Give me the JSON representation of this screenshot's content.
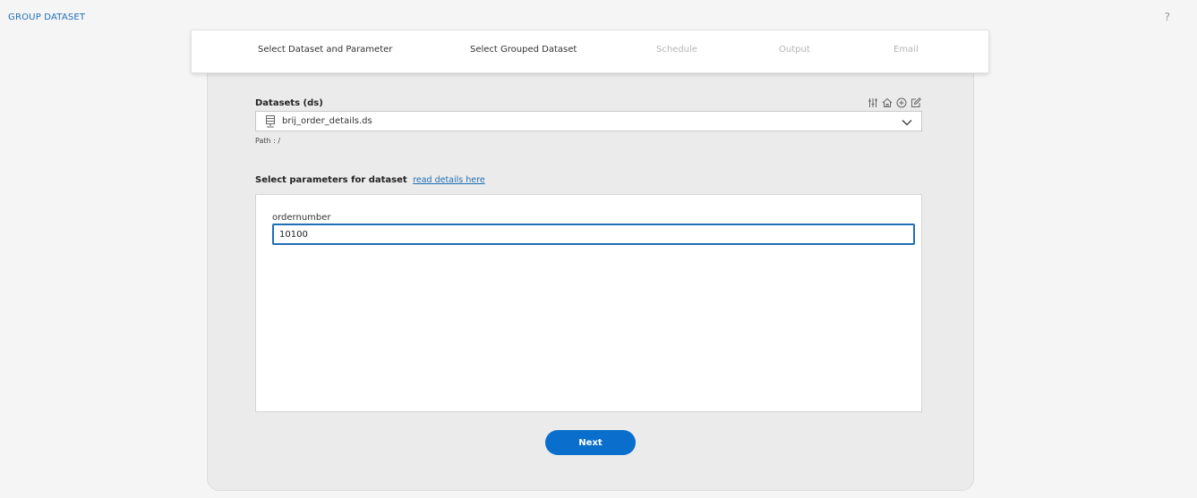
{
  "header": {
    "title": "GROUP DATASET",
    "help": "?"
  },
  "stepper": {
    "steps": [
      {
        "label": "Select Dataset and Parameter",
        "state": "active"
      },
      {
        "label": "Select Grouped Dataset",
        "state": "active"
      },
      {
        "label": "Schedule",
        "state": "inactive"
      },
      {
        "label": "Output",
        "state": "inactive"
      },
      {
        "label": "Email",
        "state": "inactive"
      }
    ]
  },
  "dataset": {
    "label": "Datasets (ds)",
    "selected": "brij_order_details.ds",
    "path": "Path : /",
    "tools": [
      "filter-sliders-icon",
      "home-icon",
      "add-circle-icon",
      "edit-icon"
    ]
  },
  "parameters": {
    "heading": "Select parameters for dataset",
    "link": "read details here",
    "fields": [
      {
        "label": "ordernumber",
        "value": "10100"
      }
    ]
  },
  "actions": {
    "next_label": "Next"
  },
  "colors": {
    "accent": "#1f6fb5",
    "button": "#0a6fcc",
    "panel_bg": "#ebebeb",
    "page_bg": "#f5f5f5"
  }
}
